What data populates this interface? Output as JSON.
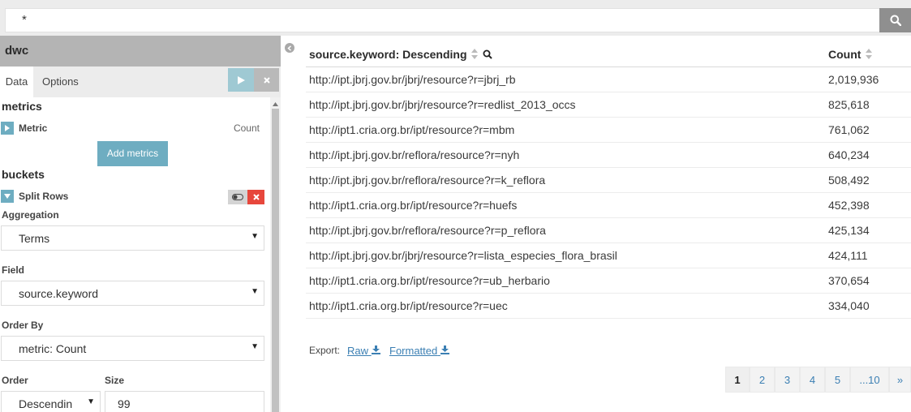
{
  "query": {
    "value": "*",
    "search_icon": "search-icon"
  },
  "sidebar": {
    "index_title": "dwc",
    "tabs": [
      "Data",
      "Options"
    ],
    "metrics": {
      "heading": "metrics",
      "items": [
        {
          "label": "Metric",
          "value": "Count"
        }
      ],
      "add_label": "Add metrics"
    },
    "buckets": {
      "heading": "buckets",
      "agg_label": "Split Rows",
      "aggregation_label": "Aggregation",
      "aggregation_value": "Terms",
      "field_label": "Field",
      "field_value": "source.keyword",
      "order_by_label": "Order By",
      "order_by_value": "metric: Count",
      "order_label": "Order",
      "order_value": "Descendin",
      "size_label": "Size",
      "size_value": "99"
    },
    "colors": {
      "accent": "#6eadc1",
      "danger": "#e7473c"
    }
  },
  "table": {
    "columns": [
      {
        "label": "source.keyword: Descending"
      },
      {
        "label": "Count"
      }
    ],
    "rows": [
      {
        "url": "http://ipt.jbrj.gov.br/jbrj/resource?r=jbrj_rb",
        "count": "2,019,936"
      },
      {
        "url": "http://ipt.jbrj.gov.br/jbrj/resource?r=redlist_2013_occs",
        "count": "825,618"
      },
      {
        "url": "http://ipt1.cria.org.br/ipt/resource?r=mbm",
        "count": "761,062"
      },
      {
        "url": "http://ipt.jbrj.gov.br/reflora/resource?r=nyh",
        "count": "640,234"
      },
      {
        "url": "http://ipt.jbrj.gov.br/reflora/resource?r=k_reflora",
        "count": "508,492"
      },
      {
        "url": "http://ipt1.cria.org.br/ipt/resource?r=huefs",
        "count": "452,398"
      },
      {
        "url": "http://ipt.jbrj.gov.br/reflora/resource?r=p_reflora",
        "count": "425,134"
      },
      {
        "url": "http://ipt.jbrj.gov.br/jbrj/resource?r=lista_especies_flora_brasil",
        "count": "424,111"
      },
      {
        "url": "http://ipt1.cria.org.br/ipt/resource?r=ub_herbario",
        "count": "370,654"
      },
      {
        "url": "http://ipt1.cria.org.br/ipt/resource?r=uec",
        "count": "334,040"
      }
    ]
  },
  "export": {
    "label": "Export:",
    "raw": "Raw",
    "formatted": "Formatted"
  },
  "pagination": {
    "pages": [
      "1",
      "2",
      "3",
      "4",
      "5",
      "...10",
      "»"
    ],
    "current": "1"
  }
}
